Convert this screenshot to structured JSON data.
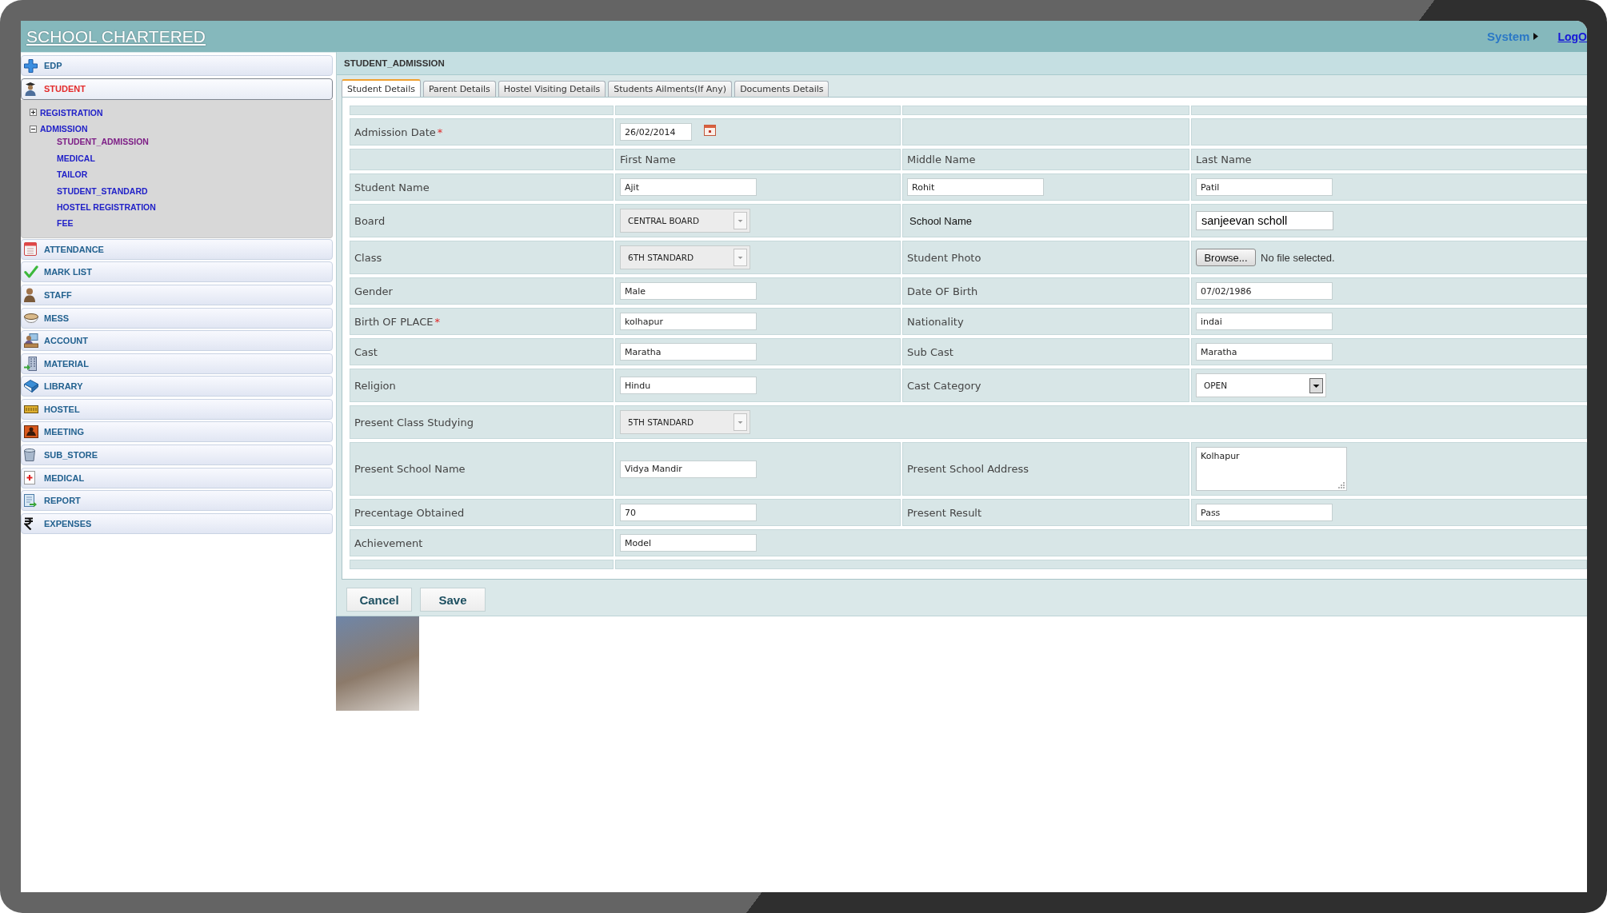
{
  "header": {
    "title": "SCHOOL CHARTERED",
    "menu": "System",
    "link": "LogO"
  },
  "sidebar": {
    "items": [
      {
        "label": "EDP",
        "selected": false
      },
      {
        "label": "STUDENT",
        "selected": true,
        "children": [
          {
            "label": "REGISTRATION",
            "expanded": false
          },
          {
            "label": "ADMISSION",
            "expanded": true,
            "children": [
              {
                "label": "STUDENT_ADMISSION",
                "selected": true
              },
              {
                "label": "MEDICAL",
                "selected": false
              },
              {
                "label": "TAILOR",
                "selected": false
              },
              {
                "label": "STUDENT_STANDARD",
                "selected": false
              },
              {
                "label": "HOSTEL REGISTRATION",
                "selected": false
              },
              {
                "label": "FEE",
                "selected": false
              }
            ]
          }
        ]
      },
      {
        "label": "ATTENDANCE",
        "selected": false
      },
      {
        "label": "MARK LIST",
        "selected": false
      },
      {
        "label": "STAFF",
        "selected": false
      },
      {
        "label": "MESS",
        "selected": false
      },
      {
        "label": "ACCOUNT",
        "selected": false
      },
      {
        "label": "MATERIAL",
        "selected": false
      },
      {
        "label": "LIBRARY",
        "selected": false
      },
      {
        "label": "HOSTEL",
        "selected": false
      },
      {
        "label": "MEETING",
        "selected": false
      },
      {
        "label": "SUB_STORE",
        "selected": false
      },
      {
        "label": "MEDICAL",
        "selected": false
      },
      {
        "label": "REPORT",
        "selected": false
      },
      {
        "label": "EXPENSES",
        "selected": false
      }
    ]
  },
  "form": {
    "title": "STUDENT_ADMISSION",
    "tabs": [
      {
        "label": "Student Details",
        "selected": true
      },
      {
        "label": "Parent Details",
        "selected": false
      },
      {
        "label": "Hostel Visiting Details",
        "selected": false
      },
      {
        "label": "Students Ailments(If Any)",
        "selected": false
      },
      {
        "label": "Documents Details",
        "selected": false
      }
    ],
    "rows": [
      {
        "kind": "spacer",
        "cells": [
          {
            "kind": "blank"
          },
          {
            "kind": "blank"
          },
          {
            "kind": "blank"
          },
          {
            "kind": "blank"
          }
        ]
      },
      {
        "kind": "field",
        "cells": [
          {
            "kind": "label",
            "text": "Admission Date",
            "mark": "*"
          },
          {
            "kind": "date",
            "value": "26/02/2014"
          },
          {
            "kind": "blank"
          },
          {
            "kind": "blank"
          }
        ]
      },
      {
        "kind": "field",
        "cells": [
          {
            "kind": "blank"
          },
          {
            "kind": "heading",
            "text": "First Name"
          },
          {
            "kind": "heading",
            "text": "Middle Name"
          },
          {
            "kind": "heading",
            "text": "Last Name"
          }
        ]
      },
      {
        "kind": "field",
        "cells": [
          {
            "kind": "label",
            "text": "Student Name"
          },
          {
            "kind": "input",
            "value": "Ajit"
          },
          {
            "kind": "input",
            "value": "Rohit"
          },
          {
            "kind": "input",
            "value": "Patil"
          }
        ]
      },
      {
        "kind": "field",
        "cells": [
          {
            "kind": "label",
            "text": "Board"
          },
          {
            "kind": "select",
            "value": "CENTRAL BOARD",
            "disabled": true
          },
          {
            "kind": "altlabel",
            "text": "School Name"
          },
          {
            "kind": "altinput",
            "value": "sanjeevan scholl"
          }
        ]
      },
      {
        "kind": "field",
        "cells": [
          {
            "kind": "label",
            "text": "Class"
          },
          {
            "kind": "select",
            "value": "6TH STANDARD",
            "disabled": true
          },
          {
            "kind": "label",
            "text": "Student Photo"
          },
          {
            "kind": "file",
            "button": "Browse...",
            "status": "No file selected."
          }
        ]
      },
      {
        "kind": "field",
        "cells": [
          {
            "kind": "label",
            "text": "Gender"
          },
          {
            "kind": "input",
            "value": "Male"
          },
          {
            "kind": "label",
            "text": "Date OF Birth"
          },
          {
            "kind": "input",
            "value": "07/02/1986"
          }
        ]
      },
      {
        "kind": "field",
        "cells": [
          {
            "kind": "label",
            "text": "Birth OF PLACE",
            "mark": "*"
          },
          {
            "kind": "input",
            "value": "kolhapur"
          },
          {
            "kind": "label",
            "text": "Nationality"
          },
          {
            "kind": "input",
            "value": "indai"
          }
        ]
      },
      {
        "kind": "field",
        "cells": [
          {
            "kind": "label",
            "text": "Cast"
          },
          {
            "kind": "input",
            "value": "Maratha"
          },
          {
            "kind": "label",
            "text": "Sub Cast"
          },
          {
            "kind": "input",
            "value": "Maratha"
          }
        ]
      },
      {
        "kind": "field",
        "cells": [
          {
            "kind": "label",
            "text": "Religion"
          },
          {
            "kind": "input",
            "value": "Hindu"
          },
          {
            "kind": "label",
            "text": "Cast Category"
          },
          {
            "kind": "select",
            "value": "OPEN",
            "disabled": false
          }
        ]
      },
      {
        "kind": "field",
        "cells": [
          {
            "kind": "label",
            "text": "Present Class Studying"
          },
          {
            "kind": "select",
            "value": "5TH STANDARD",
            "disabled": true
          }
        ]
      },
      {
        "kind": "field",
        "cells": [
          {
            "kind": "label",
            "text": "Present School Name"
          },
          {
            "kind": "input",
            "value": "Vidya Mandir"
          },
          {
            "kind": "label",
            "text": "Present School Address"
          },
          {
            "kind": "textarea",
            "value": "Kolhapur"
          }
        ]
      },
      {
        "kind": "field",
        "cells": [
          {
            "kind": "label",
            "text": "Precentage Obtained"
          },
          {
            "kind": "input",
            "value": "70"
          },
          {
            "kind": "label",
            "text": "Present Result"
          },
          {
            "kind": "input",
            "value": "Pass"
          }
        ]
      },
      {
        "kind": "field",
        "cells": [
          {
            "kind": "label",
            "text": "Achievement"
          },
          {
            "kind": "input",
            "value": "Model"
          }
        ]
      },
      {
        "kind": "spacer",
        "cells": [
          {
            "kind": "blank"
          },
          {
            "kind": "blank"
          }
        ]
      }
    ],
    "buttons": [
      "Cancel",
      "Save"
    ],
    "photo": {
      "kind": "photo"
    }
  }
}
